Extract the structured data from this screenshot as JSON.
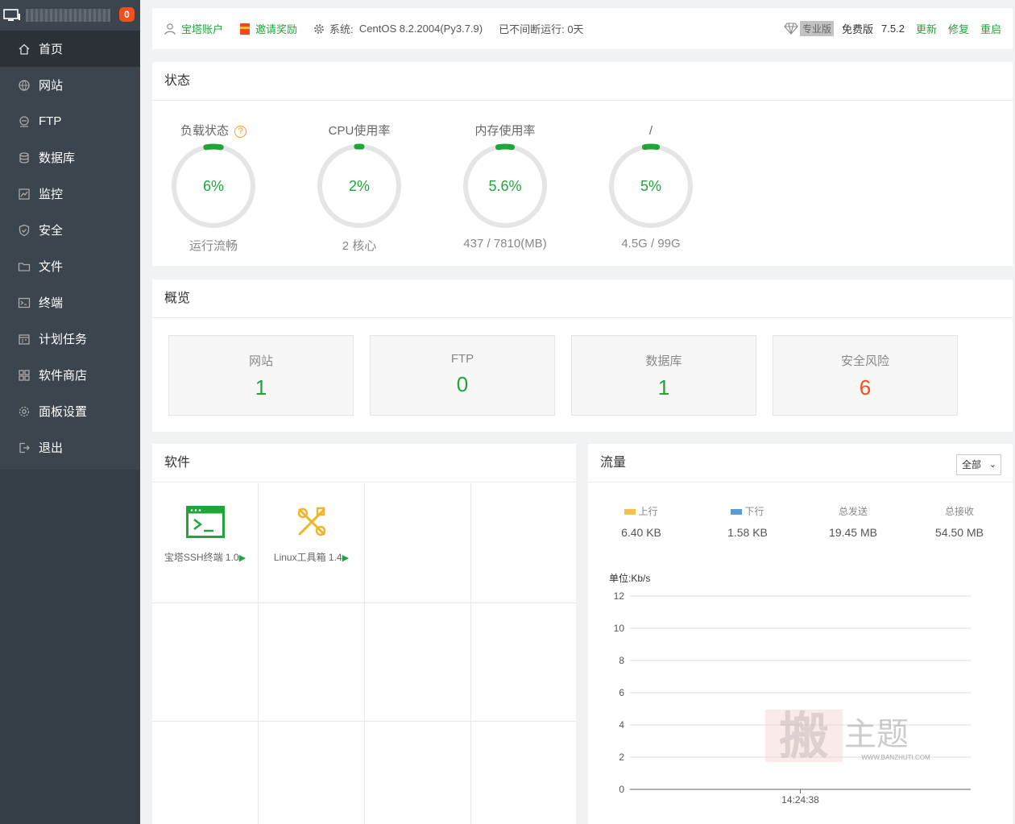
{
  "sidebar": {
    "badge": "0",
    "items": [
      {
        "label": "首页",
        "icon": "home-icon"
      },
      {
        "label": "网站",
        "icon": "globe-icon"
      },
      {
        "label": "FTP",
        "icon": "ftp-icon"
      },
      {
        "label": "数据库",
        "icon": "database-icon"
      },
      {
        "label": "监控",
        "icon": "monitor-icon"
      },
      {
        "label": "安全",
        "icon": "shield-icon"
      },
      {
        "label": "文件",
        "icon": "folder-icon"
      },
      {
        "label": "终端",
        "icon": "terminal-icon"
      },
      {
        "label": "计划任务",
        "icon": "calendar-icon"
      },
      {
        "label": "软件商店",
        "icon": "grid-icon"
      },
      {
        "label": "面板设置",
        "icon": "gear-icon"
      },
      {
        "label": "退出",
        "icon": "logout-icon"
      }
    ]
  },
  "topbar": {
    "account": "宝塔账户",
    "invite": "邀请奖励",
    "system_label": "系统:",
    "system_value": "CentOS 8.2.2004(Py3.7.9)",
    "uptime": "已不间断运行: 0天",
    "pro": "专业版",
    "free": "免费版",
    "version": "7.5.2",
    "update": "更新",
    "repair": "修复",
    "restart": "重启"
  },
  "status": {
    "title": "状态",
    "gauges": [
      {
        "label": "负载状态",
        "value": "6%",
        "percent": 6,
        "sub": "运行流畅",
        "help": "?"
      },
      {
        "label": "CPU使用率",
        "value": "2%",
        "percent": 2,
        "sub": "2 核心"
      },
      {
        "label": "内存使用率",
        "value": "5.6%",
        "percent": 5.6,
        "sub": "437 / 7810(MB)"
      },
      {
        "label": "/",
        "value": "5%",
        "percent": 5,
        "sub": "4.5G / 99G"
      }
    ]
  },
  "overview": {
    "title": "概览",
    "cards": [
      {
        "label": "网站",
        "value": "1"
      },
      {
        "label": "FTP",
        "value": "0"
      },
      {
        "label": "数据库",
        "value": "1"
      },
      {
        "label": "安全风险",
        "value": "6"
      }
    ]
  },
  "software": {
    "title": "软件",
    "items": [
      {
        "name": "宝塔SSH终端 1.0",
        "icon": "ssh-terminal-icon"
      },
      {
        "name": "Linux工具箱 1.4",
        "icon": "toolbox-icon"
      }
    ]
  },
  "traffic": {
    "title": "流量",
    "select": "全部",
    "stats": [
      {
        "label": "上行",
        "value": "6.40 KB",
        "color": "#f2c14e"
      },
      {
        "label": "下行",
        "value": "1.58 KB",
        "color": "#5b9bd5"
      },
      {
        "label": "总发送",
        "value": "19.45 MB"
      },
      {
        "label": "总接收",
        "value": "54.50 MB"
      }
    ]
  },
  "chart_data": {
    "type": "line",
    "ylabel": "单位:Kb/s",
    "ylim": [
      0,
      12
    ],
    "yticks": [
      "0",
      "2",
      "4",
      "6",
      "8",
      "10",
      "12"
    ],
    "x": [
      "14:24:38"
    ],
    "series": [
      {
        "name": "上行",
        "values": []
      },
      {
        "name": "下行",
        "values": []
      }
    ]
  },
  "watermark": {
    "text": "主题",
    "url": "WWW.BANZHUTI.COM"
  },
  "colors": {
    "accent": "#20a53a",
    "danger": "#f0501c",
    "sidebar": "#3c444d"
  }
}
